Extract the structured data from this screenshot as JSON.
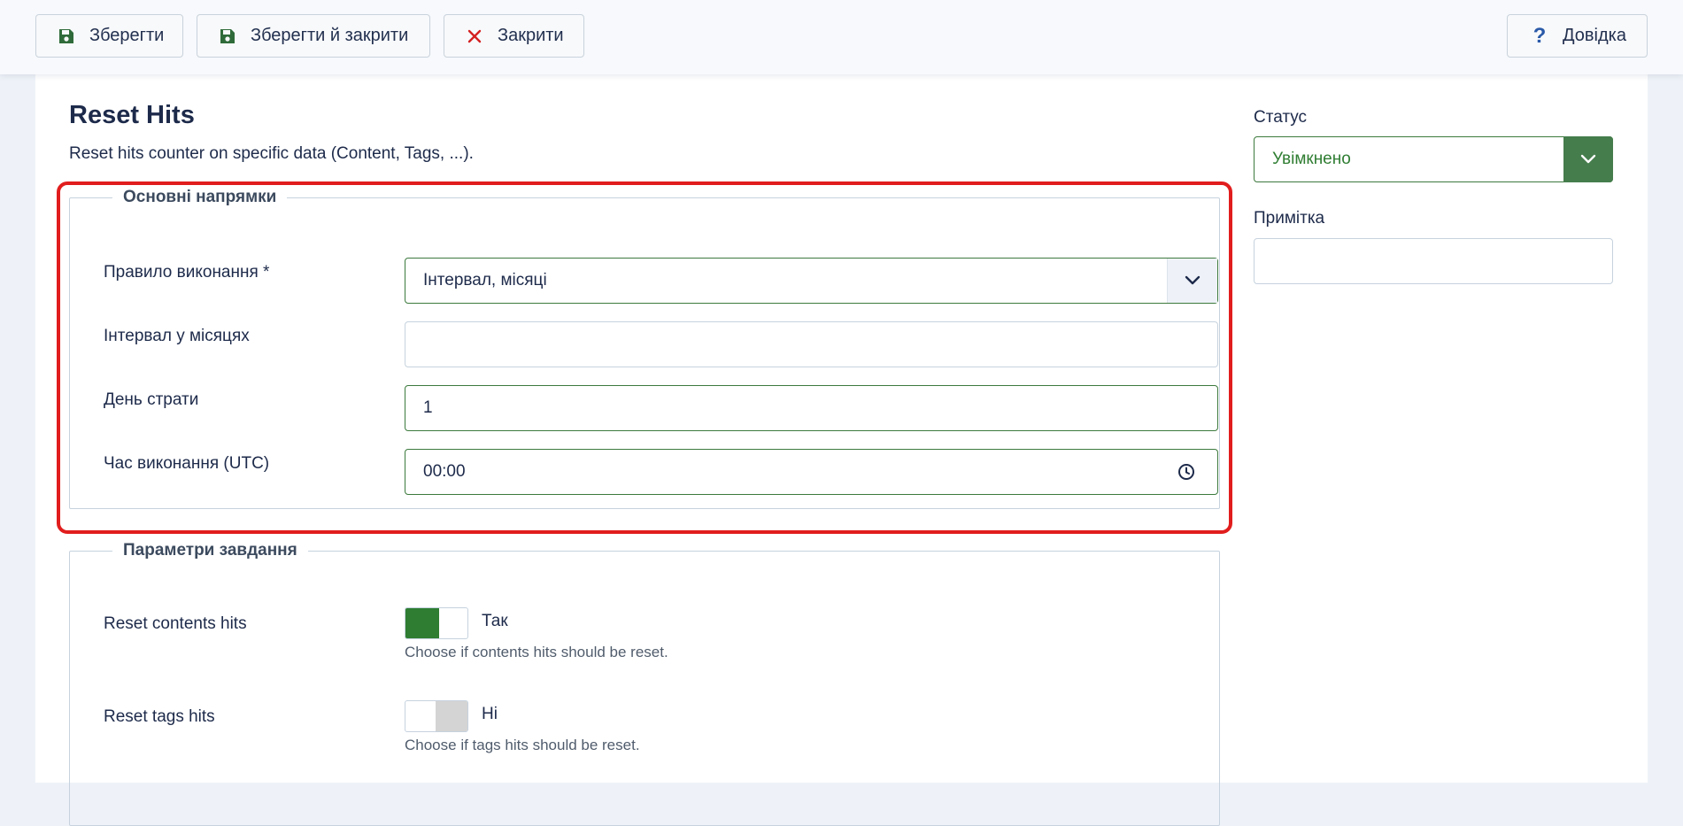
{
  "toolbar": {
    "save_label": "Зберегти",
    "save_close_label": "Зберегти й закрити",
    "close_label": "Закрити",
    "help_label": "Довідка",
    "help_glyph": "?"
  },
  "page": {
    "title": "Reset Hits",
    "description": "Reset hits counter on specific data (Content, Tags, ...)."
  },
  "main_group": {
    "legend": "Основні напрямки",
    "rule_label": "Правило виконання *",
    "rule_value": "Інтервал, місяці",
    "interval_label": "Інтервал у місяцях",
    "interval_value": "",
    "day_label": "День страти",
    "day_value": "1",
    "time_label": "Час виконання (UTC)",
    "time_value": "00:00"
  },
  "params_group": {
    "legend": "Параметри завдання",
    "contents_label": "Reset contents hits",
    "contents_state": "Так",
    "contents_hint": "Choose if contents hits should be reset.",
    "tags_label": "Reset tags hits",
    "tags_state": "Ні",
    "tags_hint": "Choose if tags hits should be reset."
  },
  "side": {
    "status_label": "Статус",
    "status_value": "Увімкнено",
    "note_label": "Примітка",
    "note_value": ""
  },
  "colors": {
    "accent_green": "#2f7d32",
    "highlight_red": "#e11d1d",
    "close_red": "#d42020"
  },
  "icons": [
    "save-icon",
    "close-icon",
    "help-icon",
    "chevron-down-icon",
    "clock-icon"
  ]
}
